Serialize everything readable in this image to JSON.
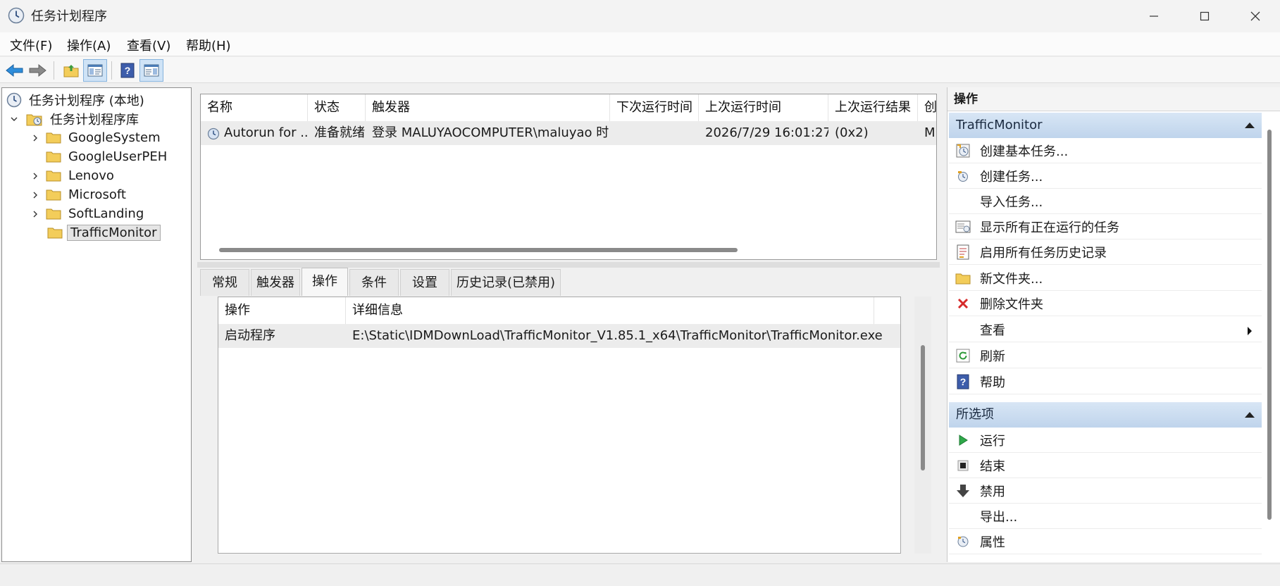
{
  "window": {
    "title": "任务计划程序",
    "icon": "clock-icon"
  },
  "menu": {
    "file": "文件(F)",
    "action": "操作(A)",
    "view": "查看(V)",
    "help": "帮助(H)"
  },
  "tree": {
    "root": "任务计划程序 (本地)",
    "library": "任务计划程序库",
    "folders": [
      "GoogleSystem",
      "GoogleUserPEH",
      "Lenovo",
      "Microsoft",
      "SoftLanding",
      "TrafficMonitor"
    ]
  },
  "task_list": {
    "columns": [
      "名称",
      "状态",
      "触发器",
      "下次运行时间",
      "上次运行时间",
      "上次运行结果",
      "创"
    ],
    "rows": [
      {
        "name": "Autorun for ...",
        "status": "准备就绪",
        "trigger": "登录 MALUYAOCOMPUTER\\maluyao 时",
        "next_run": "",
        "last_run": "2026/7/29 16:01:27",
        "last_result": "(0x2)",
        "author": "M"
      }
    ]
  },
  "tabs": [
    "常规",
    "触发器",
    "操作",
    "条件",
    "设置",
    "历史记录(已禁用)"
  ],
  "active_tab": "操作",
  "action_details": {
    "columns": [
      "操作",
      "详细信息"
    ],
    "rows": [
      {
        "action": "启动程序",
        "detail": "E:\\Static\\IDMDownLoad\\TrafficMonitor_V1.85.1_x64\\TrafficMonitor\\TrafficMonitor.exe"
      }
    ]
  },
  "actions_pane": {
    "title": "操作",
    "section1": {
      "header": "TrafficMonitor",
      "items": [
        "创建基本任务...",
        "创建任务...",
        "导入任务...",
        "显示所有正在运行的任务",
        "启用所有任务历史记录",
        "新文件夹...",
        "删除文件夹",
        "查看",
        "刷新",
        "帮助"
      ]
    },
    "section2": {
      "header": "所选项",
      "items": [
        "运行",
        "结束",
        "禁用",
        "导出...",
        "属性"
      ]
    }
  }
}
